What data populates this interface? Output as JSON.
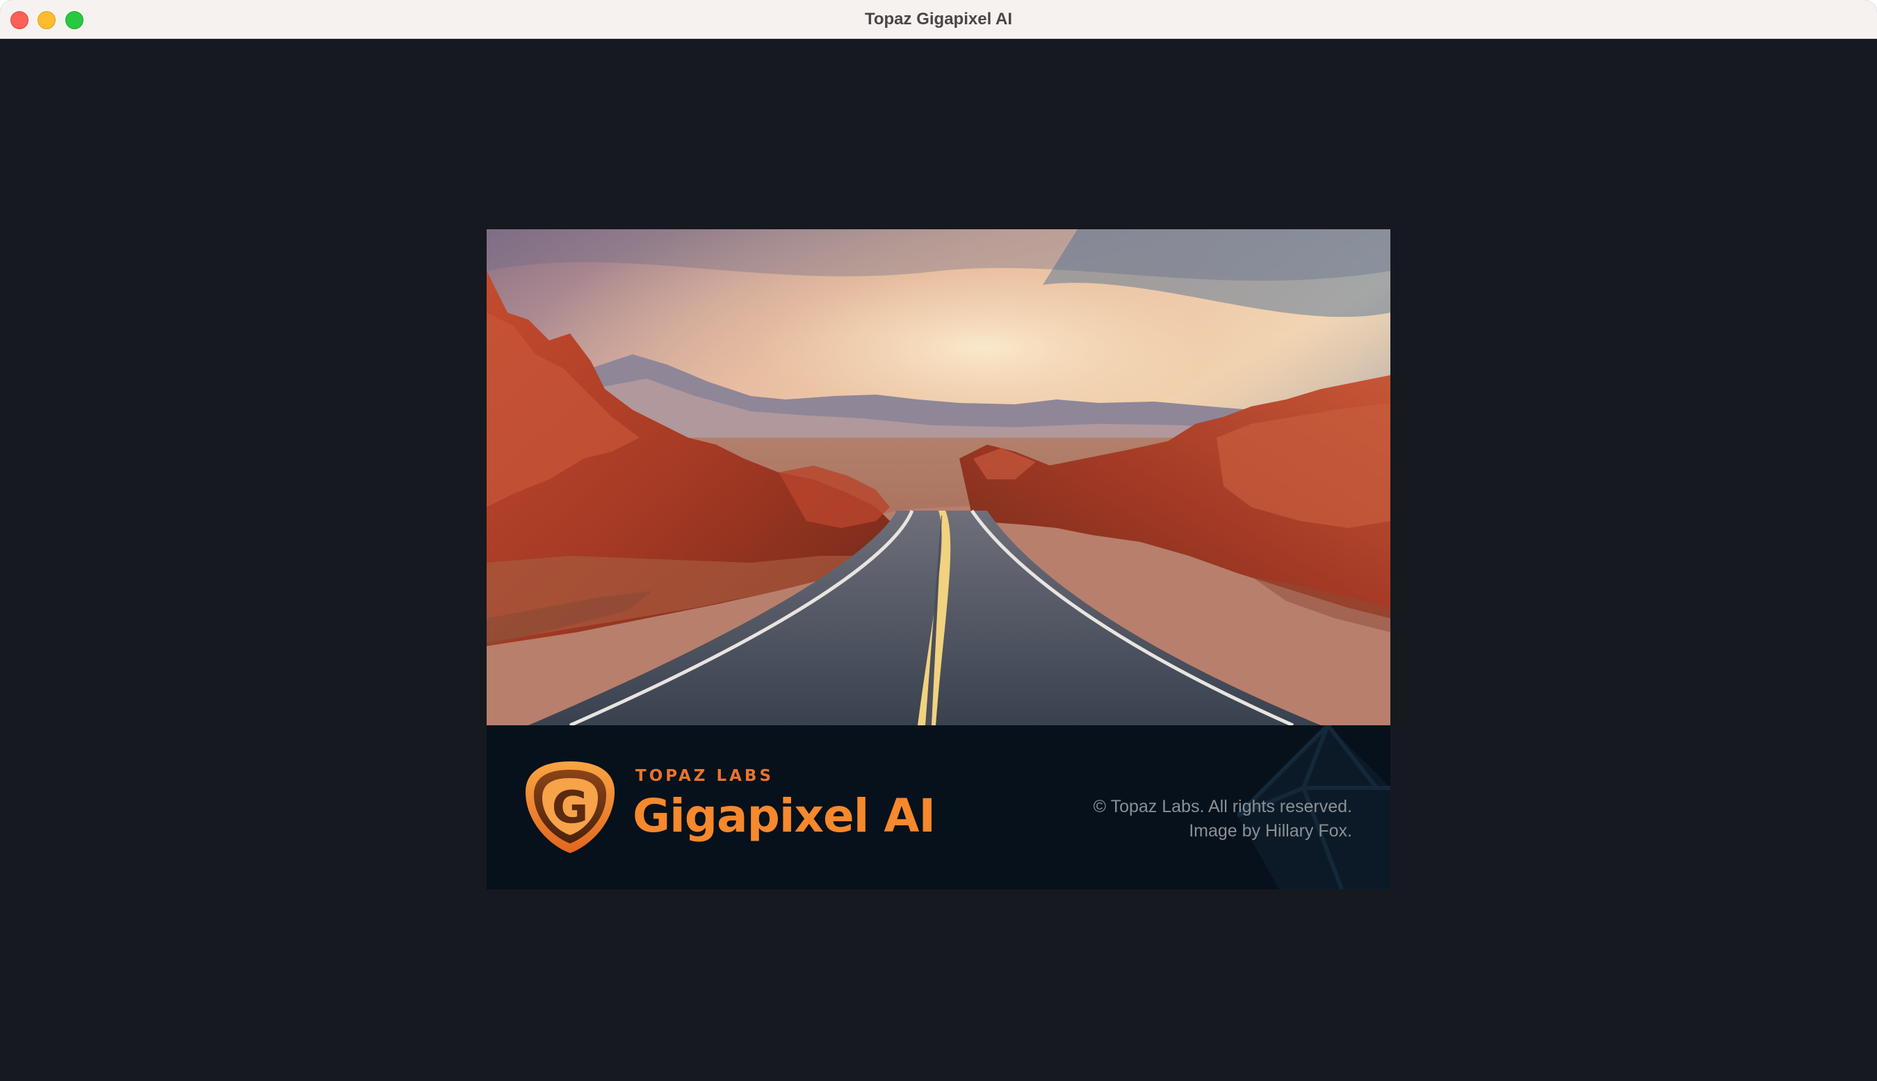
{
  "window": {
    "title": "Topaz Gigapixel AI"
  },
  "splash": {
    "brand_small": "TOPAZ LABS",
    "brand_big": "Gigapixel AI",
    "logo_letter": "G",
    "copyright": "© Topaz Labs. All rights reserved.",
    "image_credit": "Image by Hillary Fox.",
    "photo_subject": "desert-road-photo"
  },
  "colors": {
    "window_background": "#161920",
    "titlebar_background": "#f6f2f0",
    "splash_footer": "#07111b",
    "brand_orange": "#f7882c",
    "traffic_close": "#fe5f57",
    "traffic_minimize": "#febc2e",
    "traffic_maximize": "#28c840"
  }
}
